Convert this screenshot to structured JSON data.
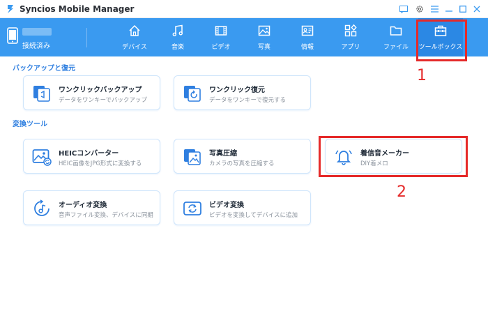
{
  "window": {
    "title": "Syncios Mobile Manager"
  },
  "device": {
    "status": "接続済み"
  },
  "nav": [
    {
      "key": "devices",
      "label": "デバイス"
    },
    {
      "key": "music",
      "label": "音楽"
    },
    {
      "key": "video",
      "label": "ビデオ"
    },
    {
      "key": "photos",
      "label": "写真"
    },
    {
      "key": "info",
      "label": "情報"
    },
    {
      "key": "apps",
      "label": "アプリ"
    },
    {
      "key": "files",
      "label": "ファイル"
    },
    {
      "key": "toolbox",
      "label": "ツールボックス"
    }
  ],
  "sections": {
    "backup": {
      "title": "バックアップと復元",
      "cards": [
        {
          "title": "ワンクリックバックアップ",
          "desc": "データをワンキーでバックアップ"
        },
        {
          "title": "ワンクリック復元",
          "desc": "データをワンキーで復元する"
        }
      ]
    },
    "convert": {
      "title": "変換ツール",
      "cards": [
        {
          "title": "HEICコンバーター",
          "desc": "HEIC画像をJPG形式に変換する"
        },
        {
          "title": "写真圧縮",
          "desc": "カメラの写真を圧縮する"
        },
        {
          "title": "着信音メーカー",
          "desc": "DIY着メロ"
        },
        {
          "title": "オーディオ変換",
          "desc": "音声ファイル変換、デバイスに同期"
        },
        {
          "title": "ビデオ変換",
          "desc": "ビデオを変換してデバイスに追加"
        }
      ]
    }
  },
  "annotations": {
    "one": "1",
    "two": "2"
  },
  "colors": {
    "accent": "#3a9af0",
    "highlight": "#e52a2a",
    "section": "#2f7fe0"
  }
}
